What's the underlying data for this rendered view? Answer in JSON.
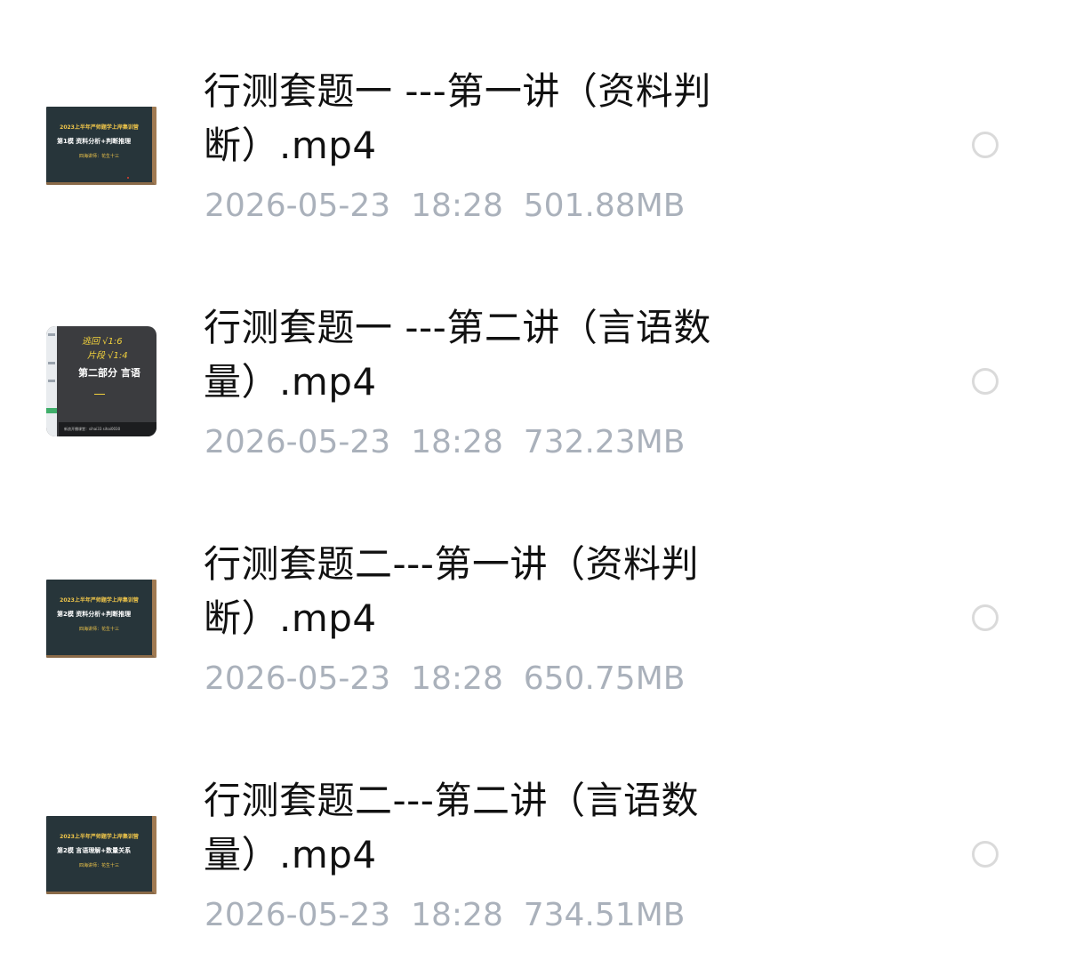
{
  "files": [
    {
      "title": "行测套题一 ---第一讲（资料判断）.mp4",
      "date": "2026-05-23",
      "time": "18:28",
      "size": "501.88MB",
      "thumbnail": {
        "kind": "chalkboard",
        "line1": "2023上半年严师题学上岸集训营",
        "line2": "第1模  资料分析+判断推理",
        "line3": "四海讲师：花生十三"
      },
      "selected": false
    },
    {
      "title": "行测套题一 ---第二讲（言语数量）.mp4",
      "date": "2026-05-23",
      "time": "18:28",
      "size": "732.23MB",
      "thumbnail": {
        "kind": "video-frame",
        "hand1": "逃回  √1:6",
        "hand2": "片段  √1:4",
        "title": "第二部分  言语",
        "footer": "新浪开播课堂：sihai33  sihai0030"
      },
      "selected": false
    },
    {
      "title": "行测套题二---第一讲（资料判断）.mp4",
      "date": "2026-05-23",
      "time": "18:28",
      "size": "650.75MB",
      "thumbnail": {
        "kind": "chalkboard",
        "line1": "2023上半年严师题学上岸集训营",
        "line2": "第2模  资料分析+判断推理",
        "line3": "四海讲师：花生十三"
      },
      "selected": false
    },
    {
      "title": "行测套题二---第二讲（言语数量）.mp4",
      "date": "2026-05-23",
      "time": "18:28",
      "size": "734.51MB",
      "thumbnail": {
        "kind": "chalkboard",
        "line1": "2023上半年严师题学上岸集训营",
        "line2": "第2模  言语理解+数量关系",
        "line3": "四海讲师：花生十三"
      },
      "selected": false
    }
  ],
  "colors": {
    "title_text": "#111111",
    "meta_text": "#aab1bb",
    "radio_border": "#dadada",
    "chalkboard": "#27353a",
    "chalk_yellow": "#f0c64a"
  },
  "icons": {
    "select": "radio-circle-icon"
  }
}
